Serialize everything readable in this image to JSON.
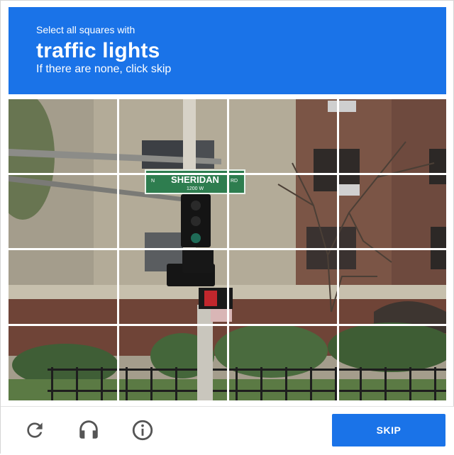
{
  "challenge": {
    "instruction_small": "Select all squares with",
    "object_name": "traffic lights",
    "instruction_sub": "If there are none, click skip"
  },
  "grid": {
    "rows": 4,
    "columns": 4,
    "photo_text": {
      "sign_main": "SHERIDAN",
      "sign_prefix": "N",
      "sign_suffix": "RD",
      "sign_number": "1200 W"
    },
    "tiles": [
      {
        "row": 1,
        "col": 1,
        "selected": false
      },
      {
        "row": 1,
        "col": 2,
        "selected": false
      },
      {
        "row": 1,
        "col": 3,
        "selected": false
      },
      {
        "row": 1,
        "col": 4,
        "selected": false
      },
      {
        "row": 2,
        "col": 1,
        "selected": false
      },
      {
        "row": 2,
        "col": 2,
        "selected": false
      },
      {
        "row": 2,
        "col": 3,
        "selected": false
      },
      {
        "row": 2,
        "col": 4,
        "selected": false
      },
      {
        "row": 3,
        "col": 1,
        "selected": false
      },
      {
        "row": 3,
        "col": 2,
        "selected": false
      },
      {
        "row": 3,
        "col": 3,
        "selected": false
      },
      {
        "row": 3,
        "col": 4,
        "selected": false
      },
      {
        "row": 4,
        "col": 1,
        "selected": false
      },
      {
        "row": 4,
        "col": 2,
        "selected": false
      },
      {
        "row": 4,
        "col": 3,
        "selected": false
      },
      {
        "row": 4,
        "col": 4,
        "selected": false
      }
    ]
  },
  "footer": {
    "icons": [
      "reload-icon",
      "headphones-icon",
      "info-icon"
    ],
    "skip_label": "SKIP"
  },
  "colors": {
    "accent": "#1a73e8",
    "icon": "#555555"
  }
}
